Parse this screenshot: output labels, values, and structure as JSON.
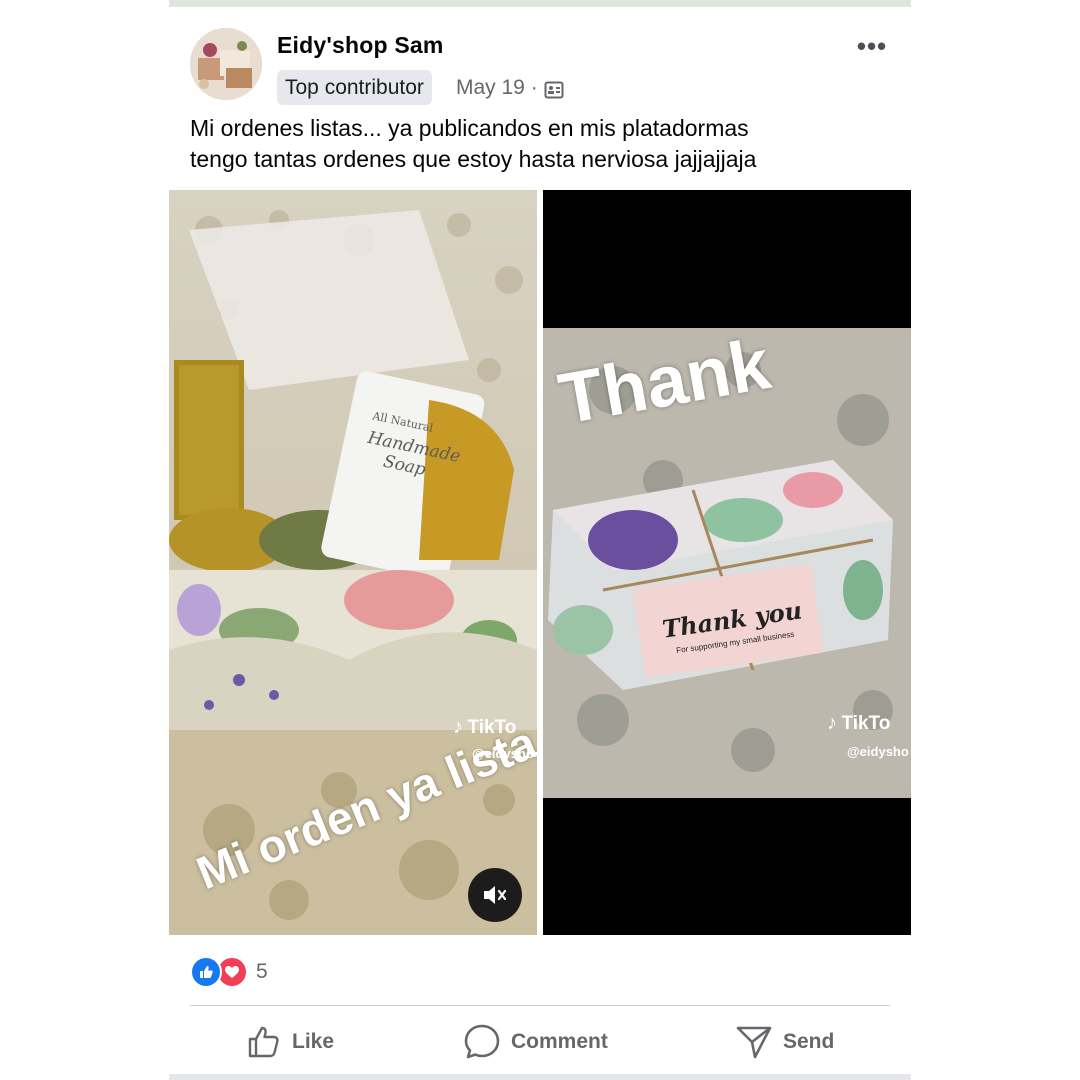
{
  "post": {
    "author": "Eidy'shop Sam",
    "badge": "Top contributor",
    "date": "May 19 ·",
    "audience_icon": "group-audience-icon",
    "more_label": "•••",
    "caption_line1": "Mi ordenes listas... ya publicandos en mis platadormas",
    "caption_line2": "tengo tantas ordenes que estoy hasta nerviosa jajjajjaja"
  },
  "media": {
    "left": {
      "overlay_text": "Mi orden ya lista",
      "tiktok_name": "TikTo",
      "tiktok_handle": "@eidysho",
      "label_line1": "All Natural",
      "label_line2": "Handmade",
      "label_line3": "Soap",
      "mute_icon": "speaker-muted-icon"
    },
    "right": {
      "overlay_text": "Thank",
      "tiktok_name": "TikTo",
      "tiktok_handle": "@eidysho",
      "card_text": "Thank you",
      "card_subtext": "For supporting my small business"
    }
  },
  "reactions": {
    "count": "5",
    "types": [
      "like-reaction-icon",
      "love-reaction-icon"
    ]
  },
  "actions": {
    "like": "Like",
    "comment": "Comment",
    "send": "Send"
  },
  "colors": {
    "like_blue": "#1877f2",
    "love_red": "#f33e58",
    "secondary_text": "#65676b"
  }
}
